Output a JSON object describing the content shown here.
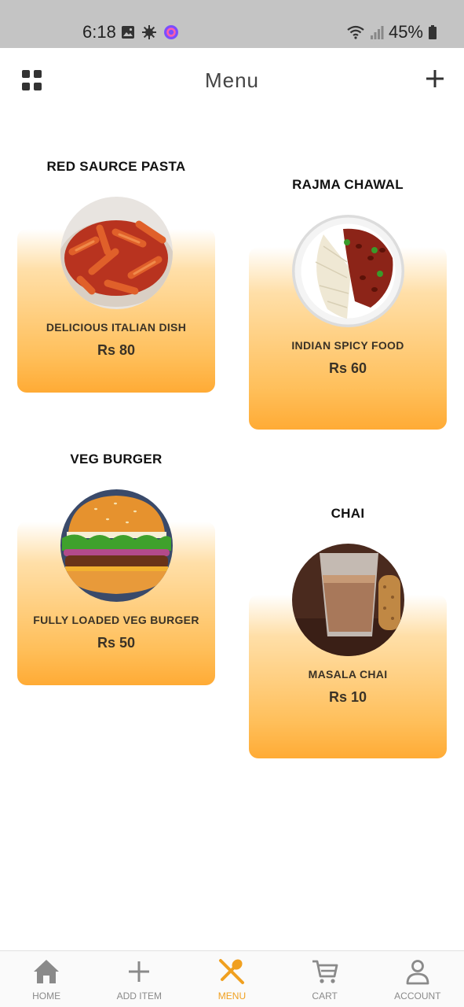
{
  "status_bar": {
    "time": "6:18",
    "battery": "45%"
  },
  "header": {
    "title": "Menu"
  },
  "menu_items": [
    {
      "name": "RED SAURCE PASTA",
      "description": "DELICIOUS ITALIAN DISH",
      "price": "Rs 80"
    },
    {
      "name": "RAJMA CHAWAL",
      "description": "INDIAN SPICY FOOD",
      "price": "Rs 60"
    },
    {
      "name": "VEG BURGER",
      "description": "FULLY LOADED VEG BURGER",
      "price": "Rs 50"
    },
    {
      "name": "CHAI",
      "description": "MASALA CHAI",
      "price": "Rs 10"
    }
  ],
  "bottom_nav": [
    {
      "label": "HOME",
      "icon": "home-icon"
    },
    {
      "label": "ADD ITEM",
      "icon": "plus-icon"
    },
    {
      "label": "MENU",
      "icon": "fork-spoon-icon",
      "active": true
    },
    {
      "label": "CART",
      "icon": "cart-icon"
    },
    {
      "label": "ACCOUNT",
      "icon": "person-icon"
    }
  ],
  "colors": {
    "accent": "#f0a020",
    "card_gradient_end": "#ffab35"
  }
}
